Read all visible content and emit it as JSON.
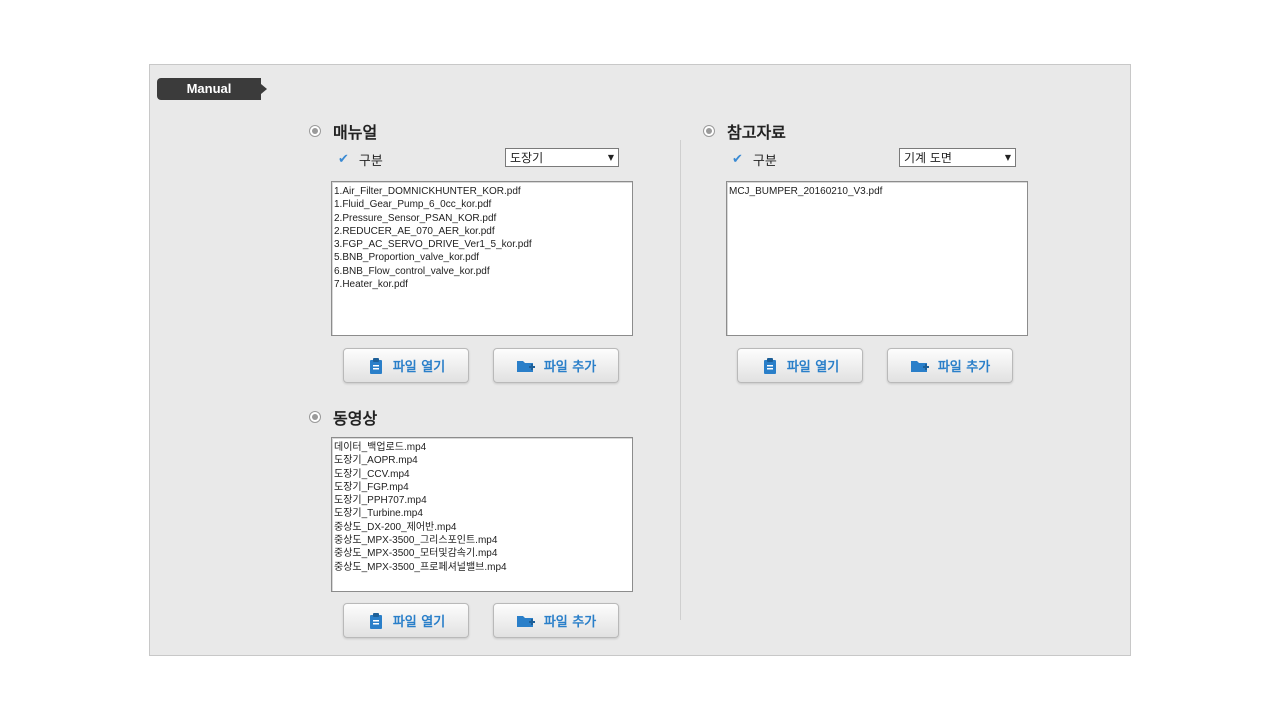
{
  "tag": "Manual",
  "manual": {
    "title": "매뉴얼",
    "category_label": "구분",
    "select_value": "도장기",
    "files": [
      "1.Air_Filter_DOMNICKHUNTER_KOR.pdf",
      "1.Fluid_Gear_Pump_6_0cc_kor.pdf",
      "2.Pressure_Sensor_PSAN_KOR.pdf",
      "2.REDUCER_AE_070_AER_kor.pdf",
      "3.FGP_AC_SERVO_DRIVE_Ver1_5_kor.pdf",
      "5.BNB_Proportion_valve_kor.pdf",
      "6.BNB_Flow_control_valve_kor.pdf",
      "7.Heater_kor.pdf"
    ],
    "open_label": "파일 열기",
    "add_label": "파일 추가"
  },
  "video": {
    "title": "동영상",
    "files": [
      "데이터_백업로드.mp4",
      "도장기_AOPR.mp4",
      "도장기_CCV.mp4",
      "도장기_FGP.mp4",
      "도장기_PPH707.mp4",
      "도장기_Turbine.mp4",
      "중상도_DX-200_제어반.mp4",
      "중상도_MPX-3500_그리스포인트.mp4",
      "중상도_MPX-3500_모터및감속기.mp4",
      "중상도_MPX-3500_프로페셔널밸브.mp4"
    ],
    "open_label": "파일 열기",
    "add_label": "파일 추가"
  },
  "reference": {
    "title": "참고자료",
    "category_label": "구분",
    "select_value": "기계 도면",
    "files": [
      "MCJ_BUMPER_20160210_V3.pdf"
    ],
    "open_label": "파일 열기",
    "add_label": "파일 추가"
  },
  "colors": {
    "accent": "#2a7fc9",
    "tag_bg": "#3b3b3b",
    "panel_bg": "#e9e9e9"
  }
}
